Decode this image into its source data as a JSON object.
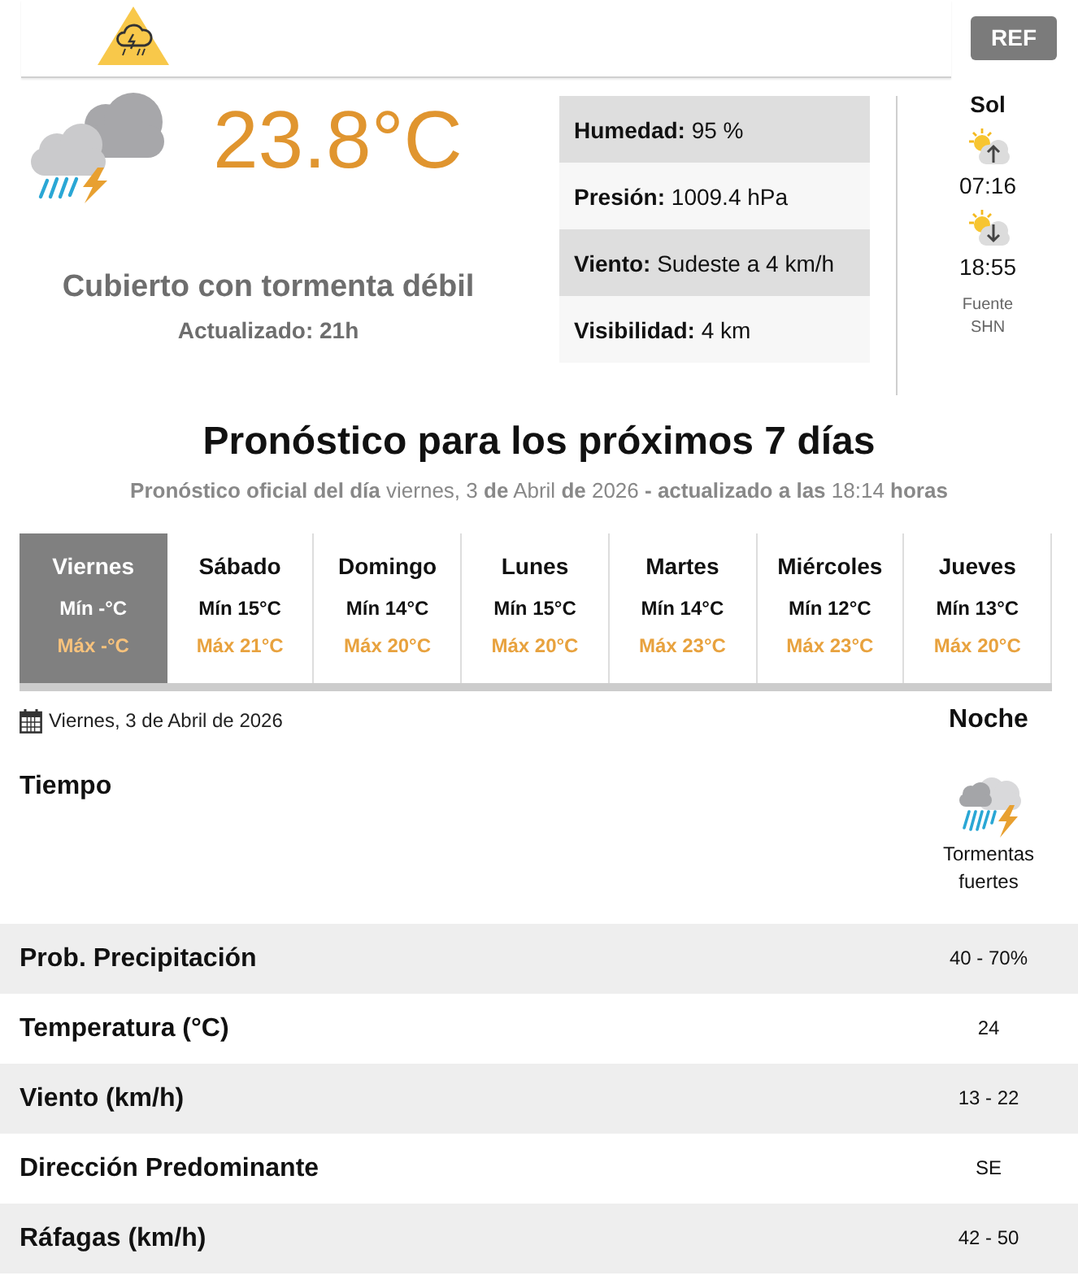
{
  "header": {
    "ref_button": "REF"
  },
  "current": {
    "temperature": "23.8°C",
    "condition": "Cubierto con tormenta débil",
    "updated": "Actualizado: 21h",
    "details": [
      "**Humedad:** 95 %",
      "**Presión:** 1009.4 hPa",
      "**Viento:** Sudeste a 4 km/h",
      "**Visibilidad:** 4 km"
    ]
  },
  "sun": {
    "title": "Sol",
    "sunrise": "07:16",
    "sunset": "18:55",
    "source": "Fuente SHN"
  },
  "forecast": {
    "title": "Pronóstico para los próximos 7 días",
    "subtitle": "**Pronóstico oficial del día** viernes, 3 **de** Abril **de** 2026 **- actualizado a las** 18:14 **horas**",
    "days": [
      {
        "name": "Viernes",
        "min": "Mín -°C",
        "max": "Máx -°C",
        "selected": true
      },
      {
        "name": "Sábado",
        "min": "Mín 15°C",
        "max": "Máx 21°C",
        "selected": false
      },
      {
        "name": "Domingo",
        "min": "Mín 14°C",
        "max": "Máx 20°C",
        "selected": false
      },
      {
        "name": "Lunes",
        "min": "Mín 15°C",
        "max": "Máx 20°C",
        "selected": false
      },
      {
        "name": "Martes",
        "min": "Mín 14°C",
        "max": "Máx 23°C",
        "selected": false
      },
      {
        "name": "Miércoles",
        "min": "Mín 12°C",
        "max": "Máx 23°C",
        "selected": false
      },
      {
        "name": "Jueves",
        "min": "Mín 13°C",
        "max": "Máx 20°C",
        "selected": false
      }
    ]
  },
  "detail": {
    "date": "Viernes, 3 de Abril de 2026",
    "period": "Noche",
    "weather_label": "Tiempo",
    "weather": "Tormentas fuertes",
    "rows": [
      {
        "label": "Prob. Precipitación",
        "value": "40 - 70%"
      },
      {
        "label": "Temperatura (°C)",
        "value": "24"
      },
      {
        "label": "Viento (km/h)",
        "value": "13 - 22"
      },
      {
        "label": "Dirección Predominante",
        "value": "SE"
      },
      {
        "label": "Ráfagas (km/h)",
        "value": "42 - 50"
      }
    ]
  }
}
